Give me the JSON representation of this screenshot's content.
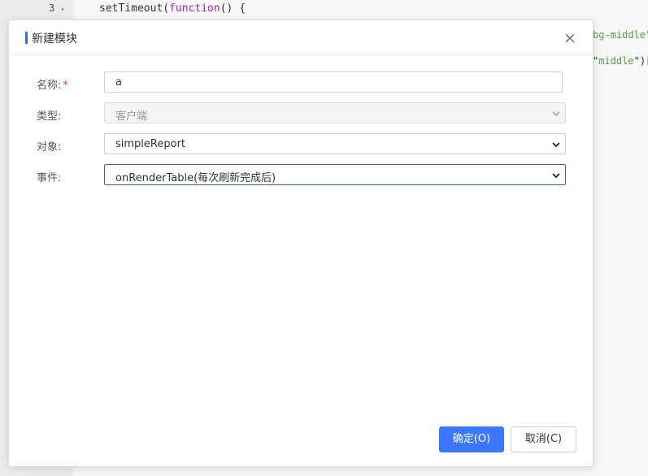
{
  "editor": {
    "line_number": "3",
    "code_line": "setTimeout(function() {",
    "code_keyword": "function",
    "right_snippet_1": "bg-middle\"",
    "right_snippet_2": "middle\")["
  },
  "dialog": {
    "title": "新建模块",
    "fields": {
      "name": {
        "label": "名称:",
        "required_mark": "*",
        "value": "a"
      },
      "type": {
        "label": "类型:",
        "value": "客户端"
      },
      "object": {
        "label": "对象:",
        "value": "simpleReport"
      },
      "event": {
        "label": "事件:",
        "value": "onRenderTable(每次刷新完成后)"
      }
    },
    "buttons": {
      "ok": "确定(O)",
      "cancel": "取消(C)"
    }
  },
  "colors": {
    "accent": "#3b78ff",
    "title_bar": "#2f6bff",
    "required": "#e53935"
  }
}
